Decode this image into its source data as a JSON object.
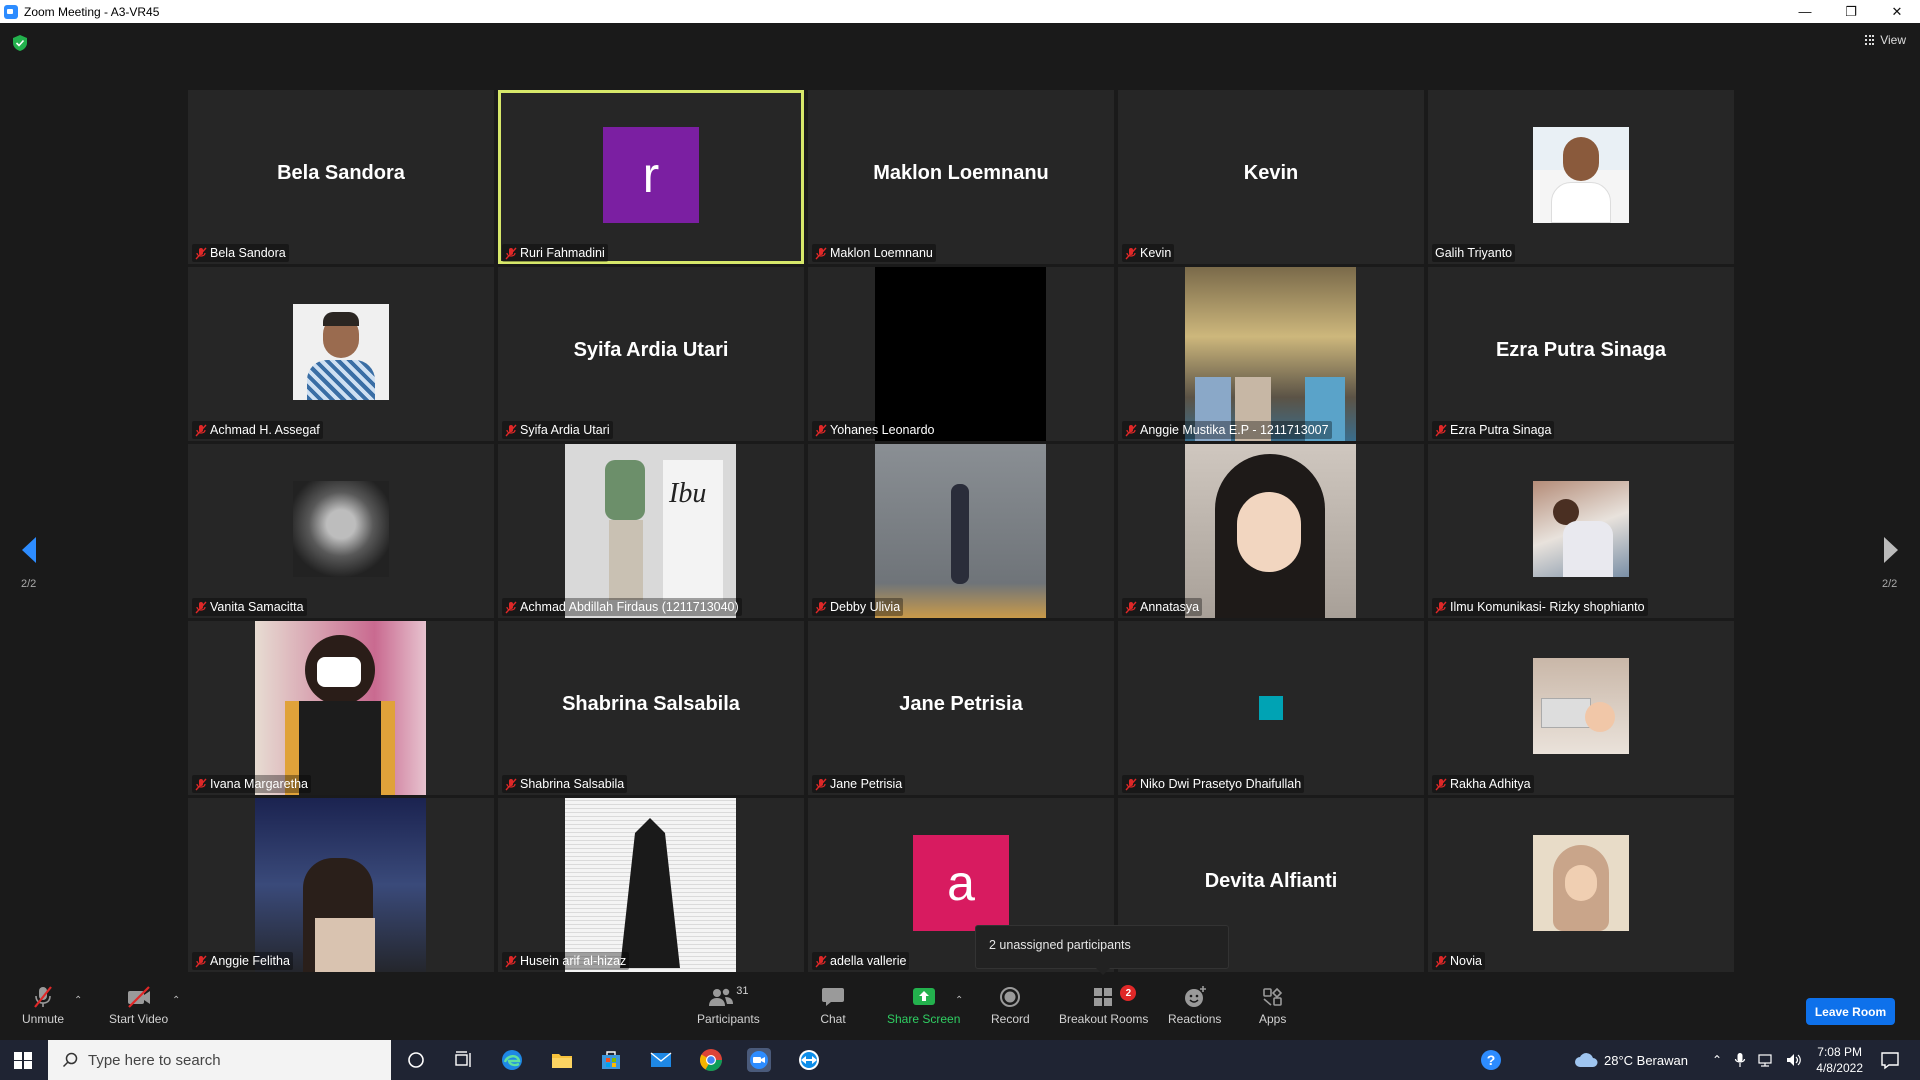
{
  "window": {
    "title": "Zoom Meeting - A3-VR45"
  },
  "stage": {
    "view_label": "View",
    "page_left": "2/2",
    "page_right": "2/2"
  },
  "tiles": [
    {
      "label": "Bela Sandora",
      "big": "Bela Sandora",
      "kind": "name",
      "muted": true
    },
    {
      "label": "Ruri Fahmadini",
      "kind": "letter",
      "letter": "r",
      "color": "#7b1fa2",
      "muted": true,
      "active": true
    },
    {
      "label": "Maklon Loemnanu",
      "big": "Maklon Loemnanu",
      "kind": "name",
      "muted": true
    },
    {
      "label": "Kevin",
      "big": "Kevin",
      "kind": "name",
      "muted": true
    },
    {
      "label": "Galih Triyanto",
      "kind": "photo",
      "muted": false
    },
    {
      "label": "Achmad H. Assegaf",
      "kind": "photo",
      "muted": true
    },
    {
      "label": "Syifa Ardia Utari",
      "big": "Syifa Ardia Utari",
      "kind": "name",
      "muted": true
    },
    {
      "label": "Yohanes Leonardo",
      "kind": "video-black",
      "muted": true
    },
    {
      "label": "Anggie Mustika E.P - 1211713007",
      "kind": "video",
      "muted": true
    },
    {
      "label": "Ezra Putra Sinaga",
      "big": "Ezra Putra Sinaga",
      "kind": "name",
      "muted": true
    },
    {
      "label": "Vanita Samacitta",
      "kind": "photo",
      "muted": true
    },
    {
      "label": "Achmad Abdillah Firdaus (1211713040)",
      "kind": "video",
      "muted": true,
      "poster_text": "Ibu"
    },
    {
      "label": "Debby Ulivia",
      "kind": "video",
      "muted": true
    },
    {
      "label": "Annatasya",
      "kind": "video",
      "muted": true
    },
    {
      "label": "Ilmu Komunikasi- Rizky shophianto",
      "kind": "photo",
      "muted": true
    },
    {
      "label": "Ivana Margaretha",
      "kind": "video",
      "muted": true
    },
    {
      "label": "Shabrina Salsabila",
      "big": "Shabrina Salsabila",
      "kind": "name",
      "muted": true
    },
    {
      "label": "Jane Petrisia",
      "big": "Jane Petrisia",
      "kind": "name",
      "muted": true
    },
    {
      "label": "Niko Dwi Prasetyo Dhaifullah",
      "kind": "square",
      "color": "#00a3b4",
      "muted": true
    },
    {
      "label": "Rakha Adhitya",
      "kind": "photo",
      "muted": true
    },
    {
      "label": "Anggie Felitha",
      "kind": "video",
      "muted": true
    },
    {
      "label": "Husein arif al-hizaz",
      "kind": "video",
      "muted": true
    },
    {
      "label": "adella vallerie",
      "kind": "letter",
      "letter": "a",
      "color": "#d81b60",
      "muted": true
    },
    {
      "label": "",
      "big": "Devita Alfianti",
      "kind": "name",
      "muted": false
    },
    {
      "label": "Novia",
      "kind": "photo",
      "muted": true
    }
  ],
  "tooltip": {
    "text": "2 unassigned participants"
  },
  "toolbar": {
    "unmute": "Unmute",
    "start_video": "Start Video",
    "participants": "Participants",
    "participants_count": "31",
    "chat": "Chat",
    "share_screen": "Share Screen",
    "record": "Record",
    "breakout_rooms": "Breakout Rooms",
    "breakout_badge": "2",
    "reactions": "Reactions",
    "apps": "Apps",
    "leave": "Leave Room"
  },
  "taskbar": {
    "search_placeholder": "Type here to search",
    "weather": "28°C  Berawan",
    "time": "7:08 PM",
    "date": "4/8/2022"
  },
  "colors": {
    "accent": "#0e71eb",
    "active_outline": "#d7e86a",
    "green": "#2fce62",
    "muted_red": "#e02828"
  }
}
